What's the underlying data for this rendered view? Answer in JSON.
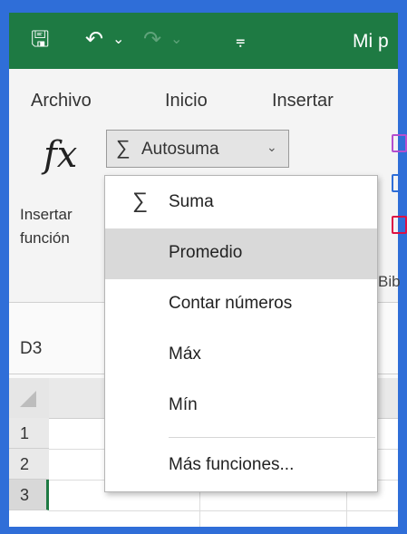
{
  "titlebar": {
    "save_glyph": "🖫",
    "undo_glyph": "↶",
    "dropdown_glyph": "⌄",
    "redo_glyph": "↷",
    "customize_glyph": "⩦",
    "title": "Mi p"
  },
  "ribbon": {
    "tabs": [
      "Archivo",
      "Inicio",
      "Insertar"
    ],
    "fx_label": "fx",
    "insert_function_line1": "Insertar",
    "insert_function_line2": "función",
    "autosum": {
      "icon": "∑",
      "label": "Autosuma",
      "chevron": "⌄"
    },
    "bib_partial": "Bib"
  },
  "namebox": {
    "value": "D3"
  },
  "rows": [
    "1",
    "2",
    "3"
  ],
  "menu": {
    "sum_icon": "∑",
    "items": [
      "Suma",
      "Promedio",
      "Contar números",
      "Máx",
      "Mín",
      "Más funciones..."
    ],
    "highlighted": "Promedio"
  },
  "colors": {
    "excel_green": "#1e7a43",
    "frame_blue": "#2f6ed8",
    "hover_gray": "#d9d9d9"
  }
}
